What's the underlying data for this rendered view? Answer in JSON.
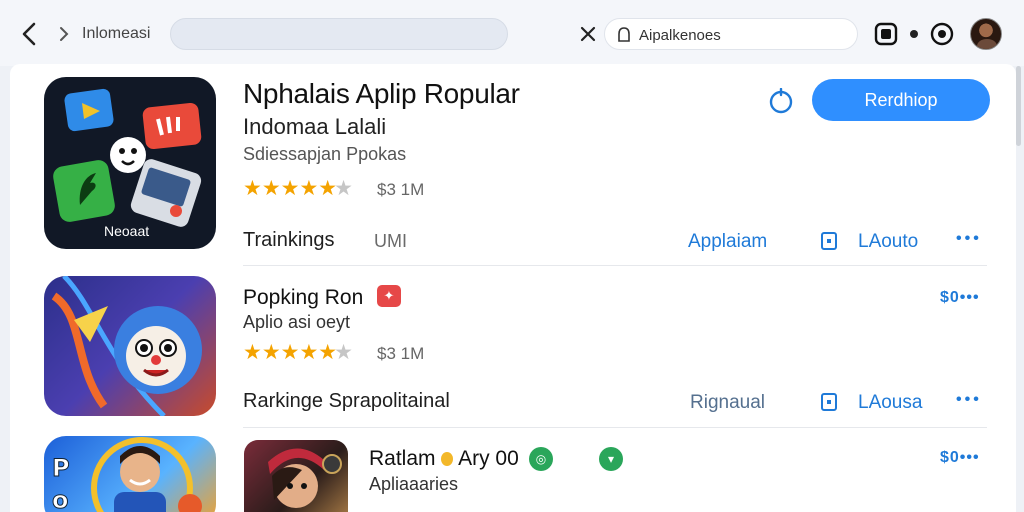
{
  "colors": {
    "accent": "#2f8fff",
    "link": "#1f7ad8",
    "star": "#f4a300",
    "badge_red": "#e64848",
    "badge_green": "#2aa65a"
  },
  "header": {
    "breadcrumb": "Inlomeasi",
    "search_text": "Aipalkenoes",
    "icons": [
      "back-arrow-icon",
      "forward-chevron-icon",
      "close-icon",
      "search-icon",
      "share-icon",
      "settings-icon",
      "avatar"
    ]
  },
  "featured": {
    "title": "Nphalais Aplip Ropular",
    "subtitle": "Indomaa Lalali",
    "developer": "Sdiessapjan Ppokas",
    "icon_label": "Neoaat",
    "rating_stars": 4.5,
    "metric": "$3 1M",
    "cta_label": "Rerdhiop",
    "row_label": "Trainkings",
    "row_value": "UMI",
    "link1": "Applaiam",
    "link2": "LAouto",
    "more": "•••"
  },
  "apps": [
    {
      "name": "Popking Ron",
      "category": "Aplio asi oeyt",
      "rating_stars": 4,
      "metric": "$3 1M",
      "price_more": "$0•••",
      "row_label": "Rarkinge Sprapolitainal",
      "link1": "Rignaual",
      "link2": "LAousa",
      "more": "•••"
    },
    {
      "name": "Ratlam",
      "name_extra": "Ary 00",
      "category": "Apliaaaries",
      "price_more": "$0•••"
    }
  ]
}
